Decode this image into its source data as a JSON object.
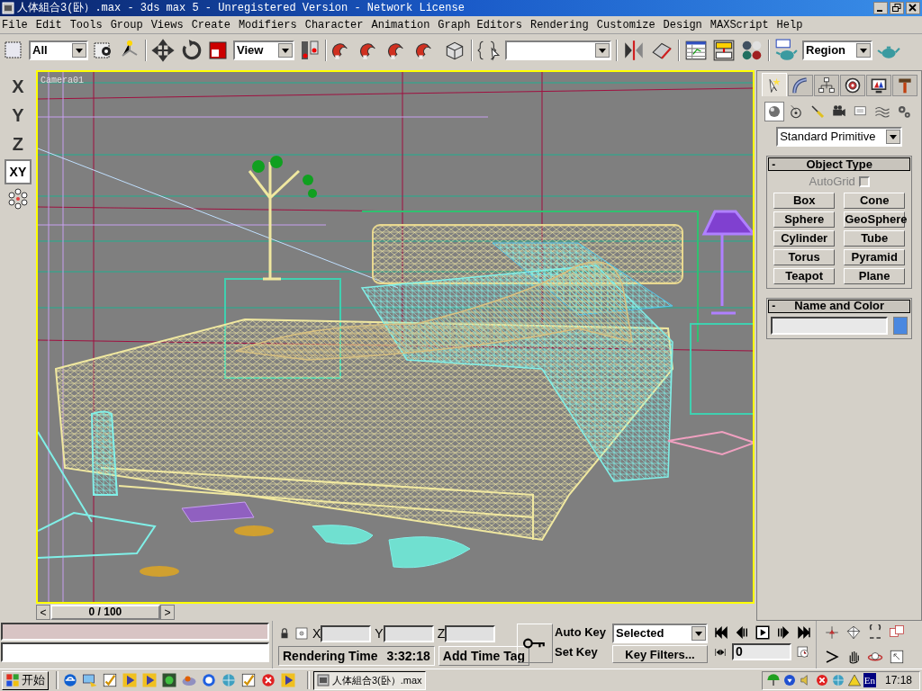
{
  "window": {
    "title": "人体組合3(卧）.max - 3ds max 5 - Unregistered Version - Network License"
  },
  "menu": [
    "File",
    "Edit",
    "Tools",
    "Group",
    "Views",
    "Create",
    "Modifiers",
    "Character",
    "Animation",
    "Graph Editors",
    "Rendering",
    "Customize",
    "Design",
    "MAXScript",
    "Help"
  ],
  "toolbar": {
    "selection_filter": "All",
    "reference_coordinate": "View",
    "render_region": "Region"
  },
  "axis_constraints": [
    {
      "label": "X",
      "selected": false
    },
    {
      "label": "Y",
      "selected": false
    },
    {
      "label": "Z",
      "selected": false
    },
    {
      "label": "XY",
      "selected": true
    }
  ],
  "viewport": {
    "label": "Camera01"
  },
  "time_slider": {
    "label": "0 / 100",
    "prev": "<",
    "next": ">"
  },
  "command_panel": {
    "tabs": [
      {
        "kind": "create",
        "selected": true
      },
      {
        "kind": "modify",
        "selected": false
      },
      {
        "kind": "hierarchy",
        "selected": false
      },
      {
        "kind": "motion",
        "selected": false
      },
      {
        "kind": "display",
        "selected": false
      },
      {
        "kind": "utilities",
        "selected": false
      }
    ],
    "categories": [
      {
        "kind": "geometry",
        "selected": true
      },
      {
        "kind": "shapes",
        "selected": false
      },
      {
        "kind": "lights",
        "selected": false
      },
      {
        "kind": "cameras",
        "selected": false
      },
      {
        "kind": "helpers",
        "selected": false
      },
      {
        "kind": "spacewarps",
        "selected": false
      },
      {
        "kind": "systems",
        "selected": false
      }
    ],
    "dropdown": "Standard Primitive",
    "object_type": {
      "toggle": "-",
      "title": "Object Type",
      "autogrid": {
        "label": "AutoGrid",
        "checked": false,
        "disabled": true
      },
      "buttons": [
        "Box",
        "Cone",
        "Sphere",
        "GeoSphere",
        "Cylinder",
        "Tube",
        "Torus",
        "Pyramid",
        "Teapot",
        "Plane"
      ]
    },
    "name_and_color": {
      "toggle": "-",
      "title": "Name and Color",
      "color": "#4a88e0"
    }
  },
  "status": {
    "coords": [
      "X",
      "Y",
      "Z"
    ],
    "rendering_label": "Rendering Time",
    "rendering_time": "3:32:18",
    "add_time_tag": "Add Time Tag",
    "auto_key": "Auto Key",
    "set_key": "Set Key",
    "key_mode": "Selected",
    "key_filters": "Key Filters...",
    "current_frame": "0"
  },
  "taskbar": {
    "start": "开始",
    "tasks": [
      {
        "label": "人体組合3(卧）.max",
        "selected": true
      }
    ],
    "language": "En",
    "clock": "17:18"
  }
}
